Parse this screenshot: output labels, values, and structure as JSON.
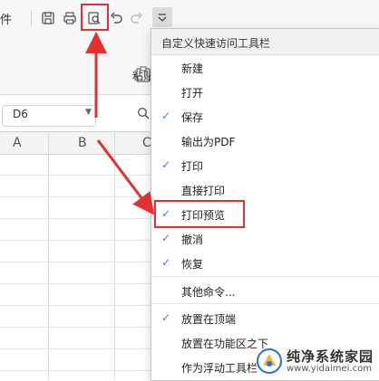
{
  "toolbar": {
    "partial_label": "件",
    "icons": [
      "save-icon",
      "print-icon",
      "print-preview-icon",
      "undo-icon",
      "redo-icon",
      "customize-dropdown-icon"
    ]
  },
  "ribbon": {
    "paste_label": "粘贴"
  },
  "formula_bar": {
    "name_box_value": "D6"
  },
  "sheet": {
    "columns": [
      "A",
      "B",
      "C"
    ]
  },
  "menu": {
    "title": "自定义快速访问工具栏",
    "items": [
      {
        "label": "新建",
        "checked": false
      },
      {
        "label": "打开",
        "checked": false
      },
      {
        "label": "保存",
        "checked": true
      },
      {
        "label": "输出为PDF",
        "checked": false
      },
      {
        "label": "打印",
        "checked": true
      },
      {
        "label": "直接打印",
        "checked": false
      },
      {
        "label": "打印预览",
        "checked": true
      },
      {
        "label": "撤消",
        "checked": true
      },
      {
        "label": "恢复",
        "checked": true
      },
      {
        "label": "其他命令...",
        "checked": false
      },
      {
        "label": "放置在顶端",
        "checked": true
      },
      {
        "label": "放置在功能区之下",
        "checked": false
      },
      {
        "label": "作为浮动工具栏",
        "checked": false
      }
    ],
    "check_glyph": "✓"
  },
  "annotations": {
    "color": "#e33030"
  },
  "watermark": {
    "title": "纯净系统家园",
    "url": "www.yidaimei.com"
  },
  "colors": {
    "toolbar_bg": "#f7f7f7",
    "check_blue": "#4a7fd4"
  }
}
